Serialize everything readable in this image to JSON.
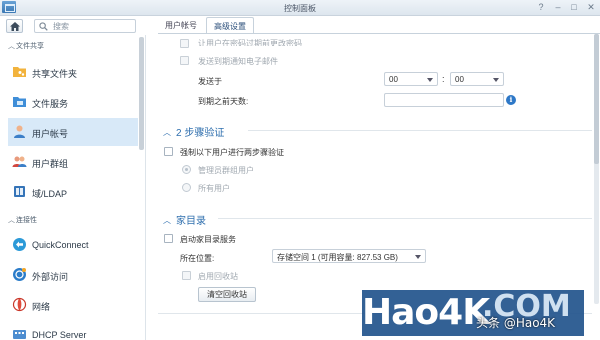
{
  "window": {
    "title": "控制面板"
  },
  "search": {
    "placeholder": "搜索"
  },
  "sidebar": {
    "sections": [
      {
        "label": "文件共享"
      },
      {
        "label": "连接性"
      }
    ],
    "items": [
      {
        "label": "共享文件夹",
        "icon": "shared-folder-icon"
      },
      {
        "label": "文件服务",
        "icon": "file-services-icon"
      },
      {
        "label": "用户帐号",
        "icon": "user-icon",
        "active": true
      },
      {
        "label": "用户群组",
        "icon": "group-icon"
      },
      {
        "label": "域/LDAP",
        "icon": "domain-icon"
      },
      {
        "label": "QuickConnect",
        "icon": "quickconnect-icon"
      },
      {
        "label": "外部访问",
        "icon": "external-access-icon"
      },
      {
        "label": "网络",
        "icon": "network-icon"
      },
      {
        "label": "DHCP Server",
        "icon": "dhcp-icon"
      }
    ]
  },
  "tabs": [
    {
      "label": "用户帐号"
    },
    {
      "label": "高级设置",
      "active": true
    }
  ],
  "content": {
    "top_cut_label": "让用户在密码过期前更改密码",
    "email_notify_label": "发送到期通知电子邮件",
    "send_at_label": "发送于",
    "hour_value": "00",
    "minute_value": "00",
    "colon": ":",
    "days_before_label": "到期之前天数:",
    "info_glyph": "i",
    "two_step": {
      "title": "2 步骤验证",
      "enforce_label": "强制以下用户进行两步骤验证",
      "option_admins": "管理员群组用户",
      "option_all": "所有用户"
    },
    "home": {
      "title": "家目录",
      "enable_label": "启动家目录服务",
      "location_label": "所在位置:",
      "location_value": "存储空间 1 (可用容量:  827.53 GB)",
      "recycle_label": "启用回收站",
      "clear_recycle_button": "清空回收站"
    }
  },
  "watermark": {
    "brand": "Hao4K",
    "tld": ".COM",
    "credit": "头条 @Hao4K"
  }
}
